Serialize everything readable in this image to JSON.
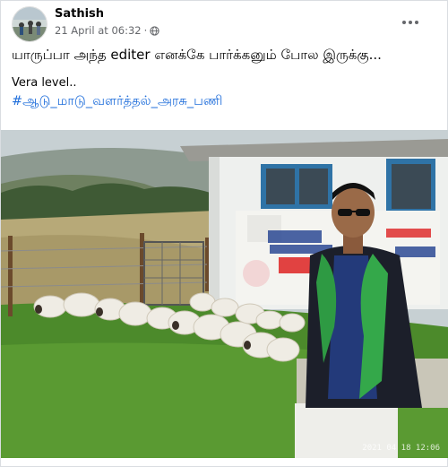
{
  "post": {
    "author": "Sathish",
    "date": "21 April at 06:32",
    "privacy_icon": "globe-icon",
    "text_line1": "யாருப்பா அந்த editer எனக்கே பார்க்கனும் போல இருக்கு...",
    "text_line2": "Vera level..",
    "hashtag": "#ஆடு_மாடு_வளர்த்தல்_அரசு_பணி"
  },
  "photo": {
    "timestamp": "2021 04 18 12:06"
  },
  "colors": {
    "link": "#216fdb",
    "meta": "#65676b"
  }
}
